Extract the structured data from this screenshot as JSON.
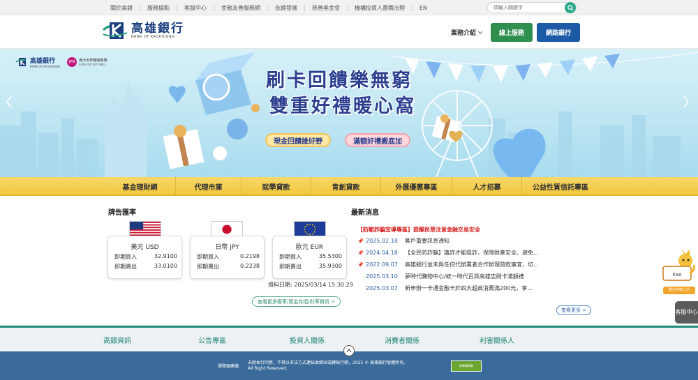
{
  "topnav": [
    "關於高銀",
    "服務據點",
    "客服中心",
    "金融友善服務網",
    "永續發展",
    "慈善基金會",
    "機構投資人盡職治理",
    "EN"
  ],
  "search": {
    "placeholder": "請輸入關鍵字"
  },
  "header": {
    "logo_cn": "高雄銀行",
    "logo_en": "BANK OF KAOHSIUNG",
    "biz_intro": "業務介紹",
    "online_service": "線上服務",
    "net_bank": "網路銀行"
  },
  "banner": {
    "logo_cn": "高雄銀行",
    "logo_en": "BANK OF KAOHSIUNG",
    "partner_badge": "JPM",
    "partner_name": "義大世界購物廣場",
    "partner_sub": "E-DA OUTLET MALL",
    "headline1": "刷卡回饋樂無窮",
    "headline2": "雙重好禮暖心窩",
    "pill1": "現金回饋誰好野",
    "pill2": "滿額好禮搬底加"
  },
  "mainnav": [
    "基金理財網",
    "代理市庫",
    "就學貸款",
    "青創貸款",
    "外匯優惠專區",
    "人才招募",
    "公益性質信託專區"
  ],
  "rates": {
    "title": "牌告匯率",
    "buy_label": "即期買入",
    "sell_label": "即期賣出",
    "cards": [
      {
        "currency": "美元 USD",
        "buy": "32.9100",
        "sell": "33.0100"
      },
      {
        "currency": "日幣 JPY",
        "buy": "0.2198",
        "sell": "0.2238"
      },
      {
        "currency": "歐元 EUR",
        "buy": "35.5300",
        "sell": "35.9300"
      }
    ],
    "date": "資料日期: 2025/03/14 15:30:29",
    "more": "查看更多匯率/黃金存摺/利率資訊 >"
  },
  "news": {
    "title": "最新消息",
    "alert": "【防範詐騙宣導專區】提醒民眾注意金融交易安全",
    "items": [
      {
        "date": "2025.02.18",
        "text": "客戶重要訊息通知",
        "pinned": true
      },
      {
        "date": "2024.04.18",
        "text": "【全民防詐騙】識詐才能阻詐，保障財產安全、避免...",
        "pinned": true
      },
      {
        "date": "2022.09.07",
        "text": "高雄銀行並未與任何代辦業者合作辦理貸款事宜，切...",
        "pinned": true
      },
      {
        "date": "2025.03.10",
        "text": "夢時代購物中心/統一時代百貨高雄店刷卡滿額禮",
        "pinned": false
      },
      {
        "date": "2025.03.07",
        "text": "新申辦一卡通金融卡於四大超商消費滿200元，享...",
        "pinned": false
      }
    ],
    "more": "查看更多 >"
  },
  "footlinks": [
    "高銀資訊",
    "公告專區",
    "投資人關係",
    "消費者關係",
    "利害關係人"
  ],
  "footer": {
    "browser": "瀏覽器建議",
    "copyright1": "未經本行同意，不得以非法方式連結本網站或轉貼行銷，2025 © 高雄銀行版權所有。",
    "copyright2": "All Right Reserved.",
    "badge": "無障礙標章"
  },
  "widgets": {
    "mascot_label": "數位存款入口",
    "mascot_name": "Kao",
    "service": "客服中心"
  },
  "colors": {
    "green": "#2f8f4e",
    "blue": "#1d5aa6",
    "yellow": "#f3c73d",
    "teal": "#1b8c7a",
    "footer": "#3b6b9a",
    "alert": "#d51d1d"
  }
}
